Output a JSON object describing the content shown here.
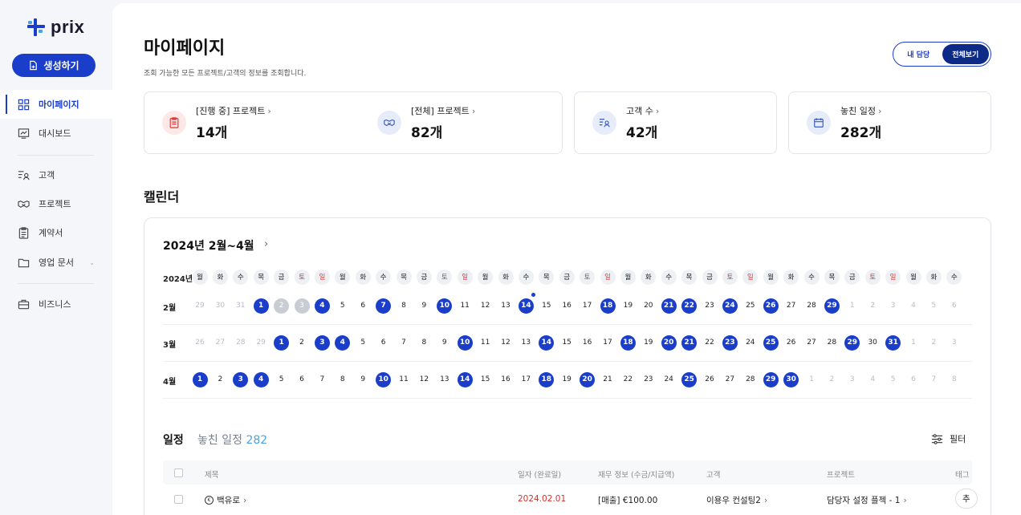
{
  "app": {
    "logo_text": "prix"
  },
  "sidebar": {
    "create_label": "생성하기",
    "items": [
      {
        "label": "마이페이지"
      },
      {
        "label": "대시보드"
      },
      {
        "label": "고객"
      },
      {
        "label": "프로젝트"
      },
      {
        "label": "계약서"
      },
      {
        "label": "영업 문서"
      },
      {
        "label": "비즈니스"
      }
    ]
  },
  "header": {
    "title": "마이페이지",
    "subtitle": "조회 가능한 모든 프로젝트/고객의 정보를 조회합니다.",
    "toggle_mine": "내 담당",
    "toggle_all": "전체보기"
  },
  "stats": [
    {
      "label": "[진행 중] 프로젝트",
      "value": "14개",
      "icon": "clipboard-icon"
    },
    {
      "label": "[전체] 프로젝트",
      "value": "82개",
      "icon": "handshake-icon"
    },
    {
      "label": "고객 수",
      "value": "42개",
      "icon": "user-list-icon"
    },
    {
      "label": "놓친 일정",
      "value": "282개",
      "icon": "calendar-icon"
    }
  ],
  "calendar": {
    "section_title": "캘린더",
    "range_label": "2024년 2월~4월",
    "year_label": "2024년",
    "weekdays": [
      "월",
      "화",
      "수",
      "목",
      "금",
      "토",
      "일",
      "월",
      "화",
      "수",
      "목",
      "금",
      "토",
      "일",
      "월",
      "화",
      "수",
      "목",
      "금",
      "토",
      "일",
      "월",
      "화",
      "수",
      "목",
      "금",
      "토",
      "일",
      "월",
      "화",
      "수",
      "목",
      "금",
      "토",
      "일",
      "월",
      "화",
      "수"
    ],
    "months": [
      {
        "label": "2월",
        "days": [
          "29",
          "30",
          "31",
          "1",
          "2",
          "3",
          "4",
          "5",
          "6",
          "7",
          "8",
          "9",
          "10",
          "11",
          "12",
          "13",
          "14",
          "15",
          "16",
          "17",
          "18",
          "19",
          "20",
          "21",
          "22",
          "23",
          "24",
          "25",
          "26",
          "27",
          "28",
          "29",
          "1",
          "2",
          "3",
          "4",
          "5",
          "6"
        ]
      },
      {
        "label": "3월",
        "days": [
          "26",
          "27",
          "28",
          "29",
          "1",
          "2",
          "3",
          "4",
          "5",
          "6",
          "7",
          "8",
          "9",
          "10",
          "11",
          "12",
          "13",
          "14",
          "15",
          "16",
          "17",
          "18",
          "19",
          "20",
          "21",
          "22",
          "23",
          "24",
          "25",
          "26",
          "27",
          "28",
          "29",
          "30",
          "31",
          "1",
          "2",
          "3"
        ]
      },
      {
        "label": "4월",
        "days": [
          "1",
          "2",
          "3",
          "4",
          "5",
          "6",
          "7",
          "8",
          "9",
          "10",
          "11",
          "12",
          "13",
          "14",
          "15",
          "16",
          "17",
          "18",
          "19",
          "20",
          "21",
          "22",
          "23",
          "24",
          "25",
          "26",
          "27",
          "28",
          "29",
          "30",
          "1",
          "2",
          "3",
          "4",
          "5",
          "6",
          "7",
          "8"
        ]
      }
    ]
  },
  "schedule": {
    "title": "일정",
    "missed_label": "놓친 일정",
    "missed_count": "282",
    "filter_label": "필터",
    "columns": [
      "제목",
      "일자 (완료일)",
      "재무 정보 (수금/지급액)",
      "고객",
      "프로젝트",
      "태그"
    ],
    "rows": [
      {
        "title": "백유로",
        "date": "2024.02.01",
        "finance": "[매출] €100.00",
        "client": "이용우 컨설팅2",
        "project": "담당자 설정 플젝 - 1",
        "tag": "추"
      }
    ]
  },
  "colors": {
    "accent": "#1a3ec9",
    "weekend": "#e03131",
    "overdue": "#d0342c",
    "count": "#4aa3e0"
  }
}
